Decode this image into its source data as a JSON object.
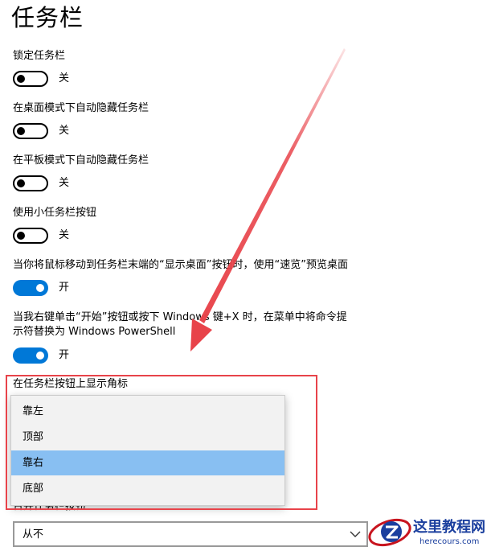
{
  "page": {
    "title": "任务栏"
  },
  "settings": [
    {
      "label": "锁定任务栏",
      "state": "关",
      "on": false
    },
    {
      "label": "在桌面模式下自动隐藏任务栏",
      "state": "关",
      "on": false
    },
    {
      "label": "在平板模式下自动隐藏任务栏",
      "state": "关",
      "on": false
    },
    {
      "label": "使用小任务栏按钮",
      "state": "关",
      "on": false
    },
    {
      "label": "当你将鼠标移动到任务栏末端的“显示桌面”按钮时，使用“速览”预览桌面",
      "state": "开",
      "on": true
    },
    {
      "label_line1": "当我右键单击“开始”按钮或按下 Windows 键+X 时，在菜单中将命令提",
      "label_line2": "示符替换为 Windows PowerShell",
      "state": "开",
      "on": true
    },
    {
      "label": "在任务栏按钮上显示角标"
    }
  ],
  "dropdown": {
    "options": [
      "靠左",
      "顶部",
      "靠右",
      "底部"
    ],
    "selected_index": 2,
    "selected_color": "#88bff2"
  },
  "partially_hidden_label": "合并任务栏按钮",
  "combine_select": {
    "value": "从不",
    "icon": "chevron-down-icon"
  },
  "colors": {
    "toggle_on": "#0078d7",
    "annotation": "#e8434a"
  },
  "watermark": {
    "title": "这里教程网",
    "url": "herecours.com"
  }
}
